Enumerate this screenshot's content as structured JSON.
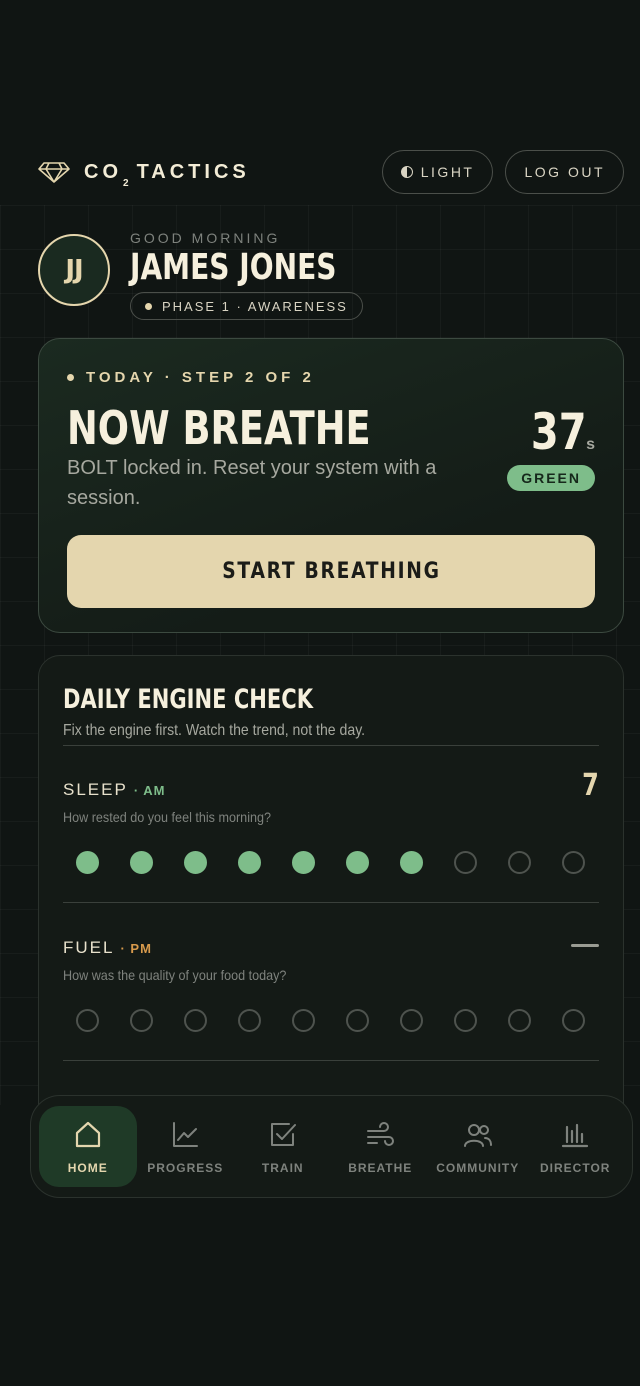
{
  "header": {
    "brand_main": "CO",
    "brand_sub": "2",
    "brand_rest": "TACTICS",
    "theme_label": "LIGHT",
    "logout_label": "LOG OUT"
  },
  "profile": {
    "initials": "JJ",
    "greeting": "GOOD MORNING",
    "name": "JAMES JONES",
    "phase": "PHASE 1 · AWARENESS"
  },
  "today": {
    "eyebrow": "TODAY · STEP 2 OF 2",
    "title": "NOW BREATHE",
    "description": "BOLT locked in. Reset your system with a session.",
    "bolt_value": "37",
    "bolt_unit": "s",
    "bolt_status": "GREEN",
    "cta": "START BREATHING"
  },
  "daily_check": {
    "title": "DAILY ENGINE CHECK",
    "subtitle": "Fix the engine first. Watch the trend, not the day.",
    "metrics": [
      {
        "label": "SLEEP",
        "when": "· AM",
        "question": "How rested do you feel this morning?",
        "value": "7",
        "rating": 7,
        "max": 10
      },
      {
        "label": "FUEL",
        "when": "· PM",
        "question": "How was the quality of your food today?",
        "value": "",
        "rating": 0,
        "max": 10
      }
    ]
  },
  "nav": {
    "items": [
      {
        "label": "HOME",
        "icon": "home-icon",
        "active": true
      },
      {
        "label": "PROGRESS",
        "icon": "chart-line-icon",
        "active": false
      },
      {
        "label": "TRAIN",
        "icon": "checkbox-icon",
        "active": false
      },
      {
        "label": "BREATHE",
        "icon": "wind-icon",
        "active": false
      },
      {
        "label": "COMMUNITY",
        "icon": "users-icon",
        "active": false
      },
      {
        "label": "DIRECTOR",
        "icon": "bar-chart-icon",
        "active": false
      }
    ]
  },
  "colors": {
    "accent_cream": "#e4d6ae",
    "accent_green": "#7ebd8a",
    "accent_orange": "#d79a4c",
    "background": "#101513"
  }
}
